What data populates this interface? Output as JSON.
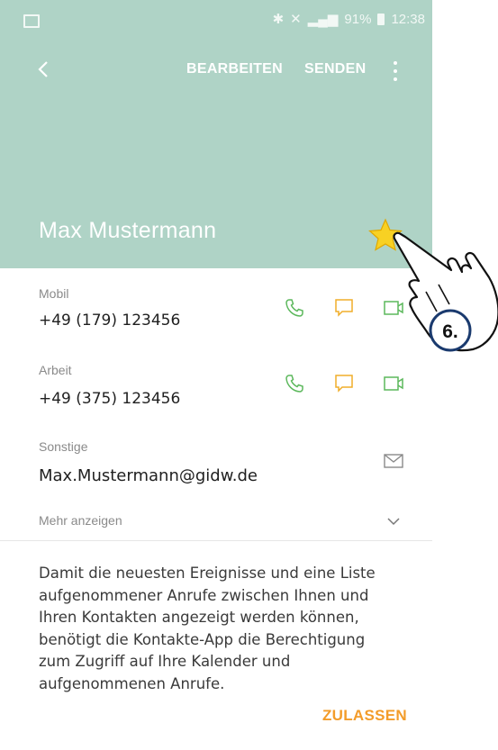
{
  "status_bar": {
    "battery": "91%",
    "time": "12:38"
  },
  "header": {
    "edit_label": "BEARBEITEN",
    "send_label": "SENDEN",
    "contact_name": "Max Mustermann",
    "accent_color": "#afd3c6"
  },
  "contacts": [
    {
      "label": "Mobil",
      "value": "+49 (179) 123456"
    },
    {
      "label": "Arbeit",
      "value": "+49 (375) 123456"
    },
    {
      "label": "Sonstige",
      "value": "Max.Mustermann@gidw.de"
    }
  ],
  "more_label": "Mehr anzeigen",
  "permission": {
    "text": "Damit die neuesten Ereignisse und eine Liste aufgenommener Anrufe zwischen Ihnen und Ihren Kontakten angezeigt werden können, benötigt die Kontakte-App die Berechtigung zum Zugriff auf Ihre Kalender und aufgenommenen Anrufe.",
    "allow_label": "ZULASSEN"
  },
  "annotation": {
    "step": "6."
  },
  "icons": {
    "call": "phone-icon",
    "message": "message-icon",
    "video": "video-icon",
    "email": "email-icon",
    "favorite": "star-icon"
  }
}
